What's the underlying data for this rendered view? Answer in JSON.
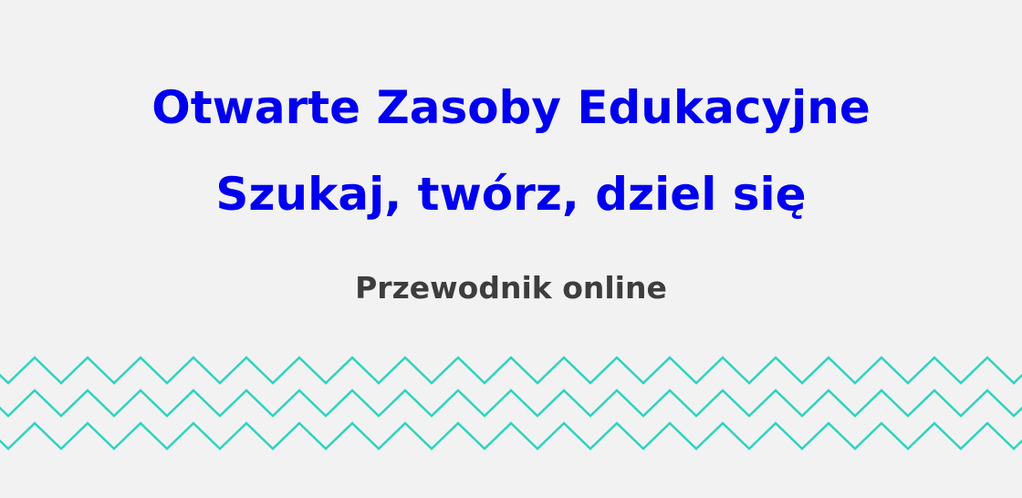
{
  "hero": {
    "title_line_1": "Otwarte Zasoby Edukacyjne",
    "title_line_2": "Szukaj, twórz, dziel się",
    "subtitle": "Przewodnik online"
  },
  "colors": {
    "background": "#f2f2f2",
    "title": "#0000ee",
    "subtitle": "#3d3d3d",
    "zigzag": "#2fd3c0"
  },
  "decoration": {
    "zigzag_rows": 3
  }
}
